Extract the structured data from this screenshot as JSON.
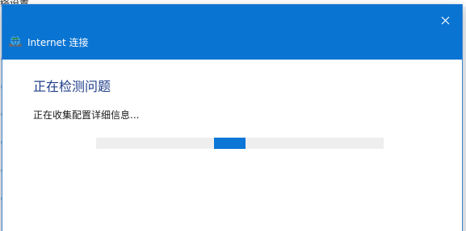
{
  "background_window": {
    "title": "络设置"
  },
  "dialog": {
    "title": "Internet 连接",
    "close_icon": "close-icon",
    "app_icon": "network-troubleshooter-icon",
    "heading": "正在检测问题",
    "status": "正在收集配置详细信息...",
    "progress": {
      "mode": "indeterminate",
      "position_fraction": 0.41,
      "block_fraction": 0.11
    }
  },
  "colors": {
    "accent": "#0a74d2",
    "heading": "#1f3e8a",
    "progress_fill": "#0b76d6",
    "progress_track": "#eeeeee"
  }
}
